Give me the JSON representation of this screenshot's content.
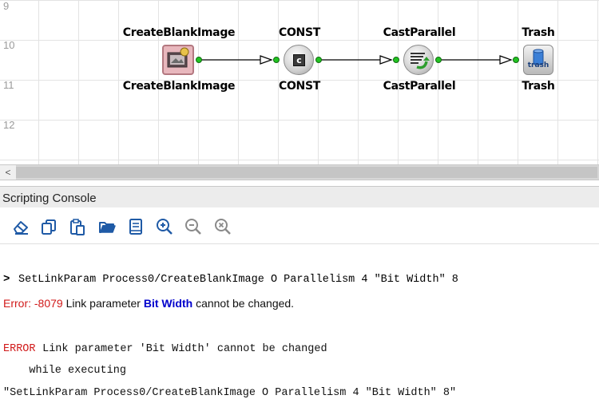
{
  "canvas": {
    "row_numbers": [
      "9",
      "10",
      "11",
      "12"
    ],
    "blocks": [
      {
        "name": "CreateBlankImage",
        "top_label": "CreateBlankImage",
        "bottom_label": "CreateBlankImage",
        "icon": "create-blank-image-icon"
      },
      {
        "name": "CONST",
        "top_label": "CONST",
        "bottom_label": "CONST",
        "icon": "const-icon"
      },
      {
        "name": "CastParallel",
        "top_label": "CastParallel",
        "bottom_label": "CastParallel",
        "icon": "cast-parallel-icon"
      },
      {
        "name": "Trash",
        "top_label": "Trash",
        "bottom_label": "Trash",
        "icon": "trash-icon",
        "icon_text": "trash"
      }
    ],
    "colors": {
      "grid": "#e3e3e3",
      "port": "#22c322"
    }
  },
  "scrollbar": {
    "left_arrow": "<"
  },
  "console": {
    "title": "Scripting Console",
    "toolbar": [
      {
        "id": "clear",
        "icon": "eraser-icon"
      },
      {
        "id": "copy",
        "icon": "copy-icon"
      },
      {
        "id": "paste",
        "icon": "paste-icon"
      },
      {
        "id": "open",
        "icon": "folder-open-icon"
      },
      {
        "id": "script",
        "icon": "script-icon"
      },
      {
        "id": "zoom-in",
        "icon": "zoom-in-icon"
      },
      {
        "id": "zoom-out",
        "icon": "zoom-out-icon"
      },
      {
        "id": "zoom-reset",
        "icon": "zoom-reset-icon"
      }
    ],
    "lines": {
      "command": {
        "prompt": ">",
        "text": "SetLinkParam Process0/CreateBlankImage O Parallelism 4 \"Bit Width\" 8"
      },
      "error1": {
        "prefix": "Error: -8079",
        "middle": " Link parameter ",
        "param": "Bit Width",
        "suffix": " cannot be changed."
      },
      "error2": {
        "keyword": "ERROR",
        "text": " Link parameter 'Bit Width' cannot be changed"
      },
      "while": "    while executing",
      "echo": "\"SetLinkParam Process0/CreateBlankImage O Parallelism 4 \"Bit Width\" 8\""
    },
    "colors": {
      "error_red": "#d11a1a",
      "param_blue": "#0000cc",
      "icon_blue": "#1f5aa6"
    }
  }
}
